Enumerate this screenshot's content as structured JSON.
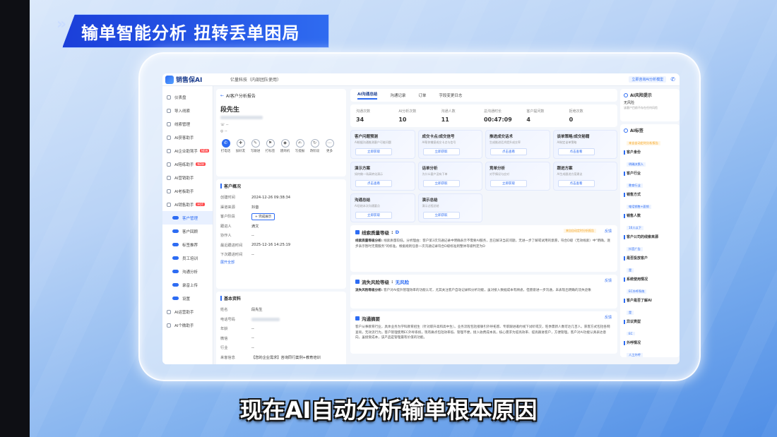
{
  "banner": {
    "title": "输单智能分析 扭转丢单困局"
  },
  "subtitle": "现在AI自动分析输单根本原因",
  "app": {
    "logo": "销售保AI",
    "org": "亿量科技（内部团队使用）",
    "top_link": "立即咨询AI分析模型"
  },
  "sidebar": {
    "items": [
      {
        "label": "仪表盘",
        "badge": ""
      },
      {
        "label": "导入线索",
        "badge": ""
      },
      {
        "label": "线索管理",
        "badge": ""
      },
      {
        "label": "AI获客助手",
        "badge": ""
      },
      {
        "label": "AI企业助驾手",
        "badge": "NEW"
      },
      {
        "label": "AI陪练助手",
        "badge": "NEW"
      },
      {
        "label": "AI营销助手",
        "badge": ""
      },
      {
        "label": "AI老板助手",
        "badge": ""
      },
      {
        "label": "AI销售助手",
        "badge": "HOT"
      }
    ],
    "sub_items": [
      "客户管理",
      "客户回顾",
      "标签推荐",
      "员工培训",
      "沟通分析",
      "录音上传",
      "设置"
    ],
    "bottom_items": [
      "AI运营助手",
      "AI个微助手"
    ]
  },
  "detail": {
    "back_label": "AI客户分析报告",
    "customer_name": "段先生",
    "actions": [
      "打电话",
      "加好友",
      "写跟进",
      "打标签",
      "建商机",
      "写提报",
      "改阶段",
      "更多"
    ],
    "overview_title": "客户概况",
    "overview": [
      {
        "k": "创建时间",
        "v": "2024-12-26 09:38:34"
      },
      {
        "k": "渠道来源",
        "v": "抖音"
      },
      {
        "k": "客户阶段",
        "v": "+ 完成展示"
      },
      {
        "k": "跟进人",
        "v": "滴文"
      },
      {
        "k": "协作人",
        "v": "--"
      },
      {
        "k": "最近跟进时间",
        "v": "2025-12-16 14:25:19"
      },
      {
        "k": "下次跟进时间",
        "v": "--"
      }
    ],
    "expand_label": "展开全部",
    "basic_title": "基本资料",
    "basic": [
      {
        "k": "姓名",
        "v": "段先生"
      },
      {
        "k": "电话号码",
        "v": ""
      },
      {
        "k": "年龄",
        "v": "--"
      },
      {
        "k": "微信",
        "v": "--"
      },
      {
        "k": "行业",
        "v": "--"
      },
      {
        "k": "来客信息",
        "v": "【您的企业需求】咨询同行案例+教育培训"
      }
    ]
  },
  "main": {
    "tabs": [
      "AI沟通总结",
      "沟通记录",
      "订单",
      "字段变更日志"
    ],
    "stats": [
      {
        "label": "沟通次数",
        "value": "34"
      },
      {
        "label": "AI分析次数",
        "value": "10"
      },
      {
        "label": "沟通人数",
        "value": "11"
      },
      {
        "label": "总沟通时长",
        "value": "00:47:09"
      },
      {
        "label": "客户提问数",
        "value": "4"
      },
      {
        "label": "拒绝次数",
        "value": "0"
      }
    ],
    "features": [
      {
        "title": "客户问题预测",
        "desc": "AI根据沟通推测客户可能问题",
        "btn": "立即获取"
      },
      {
        "title": "成交卡点/成交信号",
        "desc": "AI帮你捕捉成交卡点与信号",
        "btn": "立即获取"
      },
      {
        "title": "推进成交话术",
        "desc": "生成推进话术提升成交率",
        "btn": "点击查看"
      },
      {
        "title": "谈单策略/成交秘籍",
        "desc": "AI制定谈单策略",
        "btn": "点击查看"
      },
      {
        "title": "演示方案",
        "desc": "如何做一场高转化演示",
        "btn": "点击查看"
      },
      {
        "title": "话单分析",
        "desc": "为什么客户没有下单",
        "btn": "立即获取"
      },
      {
        "title": "竞单分析",
        "desc": "对手情况与应对",
        "btn": "立即获取"
      },
      {
        "title": "跟进方案",
        "desc": "AI生成跟进方案建议",
        "btn": "点击查看"
      },
      {
        "title": "沟通总结",
        "desc": "AI总结本次沟通要点",
        "btn": "立即获取"
      },
      {
        "title": "演示总结",
        "desc": "演示过程总结",
        "btn": "立即获取"
      }
    ],
    "lead_level": {
      "title": "线索质量等级",
      "level": "D",
      "tag": "来自自动定时分析报告",
      "feedback": "反馈",
      "text_label": "线索质量等级分析:",
      "text": "线索质量较低。分析理由：客户第3次沟通记录中明确表示不需要AI服务，且已解决当前问题，无进一步了解或试用的意愿，符合D级（无效线索）中\"明确，逐步表示暂时无需服务\"的标准。根据规则任意一次沟通记录符合D级标准则整体等级判定为D"
    },
    "churn": {
      "title": "流失风险等级",
      "level": "无风险",
      "feedback": "反馈",
      "text_label": "流失风险等级分析:",
      "text": "客户对AI提升管理效率的功能认可，尤其关注客户自动记录和分析功能，虽对接入数据成本有顾虑，但愿意进一步沟通，未表现出明确的流失迹象"
    },
    "summary": {
      "title": "沟通摘要",
      "feedback": "反馈",
      "text": "客户从事教育行业，具体业务为学科教育招生（针对职升高和高中生）。业务流程包括接联引外呼拓客、专职跟进邀约线下试听或交，旺季需新人数可达几百人。获客方式包括各网查询，无效流行为。客户管理使用EC外呼系统，现有痛点包括效率低、管理不便，接入收费成本高，核心需求为提高效率、提高跟进客户，方便管理。客户对AI功能认真表达意向，虽接受成本，该产品是管理最有价值的功能。"
    }
  },
  "right": {
    "risk_title": "AI风险提示",
    "risk_value": "无风险",
    "risk_sub": "该客户目前不存在任何风险",
    "tags_title": "AI标签",
    "tags_sub": "来自自动定时分析报告",
    "tag_groups": [
      {
        "name": "客户身份",
        "value": "明确决策人"
      },
      {
        "name": "客户行业",
        "value": "教育行业"
      },
      {
        "name": "销售方式",
        "value": "电话销售+面销"
      },
      {
        "name": "销售人数",
        "value": "10人以下"
      },
      {
        "name": "客户公司的线索来源",
        "value": "抖音广告"
      },
      {
        "name": "是否投放客户",
        "value": "是"
      },
      {
        "name": "系统使用情况",
        "value": "EC外呼系统"
      },
      {
        "name": "客户是否了解AI",
        "value": "是"
      },
      {
        "name": "异议类型",
        "value": "EC"
      },
      {
        "name": "外呼情况",
        "value": "人工外呼"
      },
      {
        "name": "是否回复邀请",
        "value": "是"
      },
      {
        "name": "客户是否回复演示邀约",
        "value": ""
      }
    ]
  }
}
